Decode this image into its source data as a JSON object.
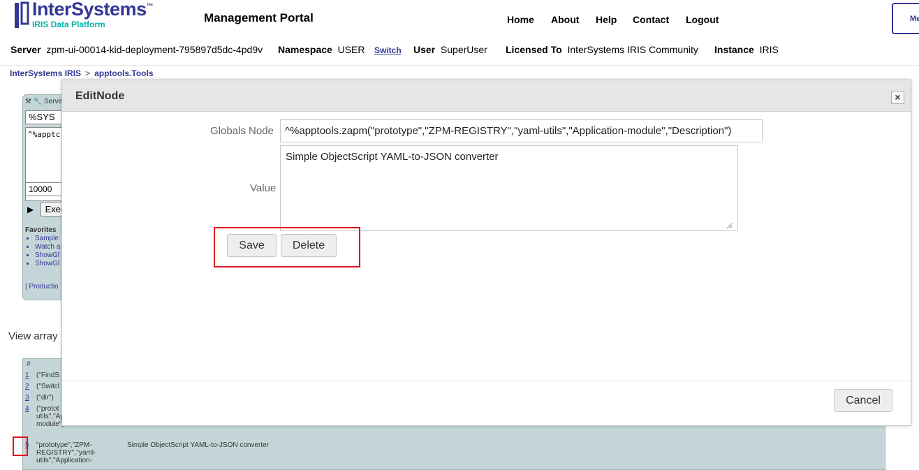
{
  "header": {
    "logo_name": "InterSystems",
    "logo_tm": "™",
    "logo_sub": "IRIS Data Platform",
    "portal_title": "Management Portal",
    "nav": [
      "Home",
      "About",
      "Help",
      "Contact",
      "Logout"
    ],
    "top_right_label": "Me"
  },
  "info": {
    "server_label": "Server",
    "server_value": "zpm-ui-00014-kid-deployment-795897d5dc-4pd9v",
    "namespace_label": "Namespace",
    "namespace_value": "USER",
    "switch_label": "Switch",
    "user_label": "User",
    "user_value": "SuperUser",
    "licensed_label": "Licensed To",
    "licensed_value": "InterSystems IRIS Community",
    "instance_label": "Instance",
    "instance_value": "IRIS"
  },
  "breadcrumb": {
    "root": "InterSystems IRIS",
    "sep": ">",
    "current": "apptools.Tools"
  },
  "panel": {
    "head": "Serve",
    "namespace": "%SYS",
    "global_ref": "^%apptc",
    "max_rows": "10000",
    "exec_label": "Exec",
    "favorites_title": "Favorites",
    "favorites": [
      "Sample",
      "Watch a",
      "ShowGl",
      "ShowGl"
    ],
    "production_link": "| Productio"
  },
  "view_array_label": "View array",
  "results": {
    "header": "#",
    "rows": [
      {
        "idx": "1",
        "key": "(\"FindS"
      },
      {
        "idx": "2",
        "key": "(\"Switcl"
      },
      {
        "idx": "3",
        "key": "(\"dir\")"
      },
      {
        "idx": "4",
        "key": "(\"protot REGIST utils\",\"Application-module\")"
      },
      {
        "idx": "5",
        "key": "\"prototype\",\"ZPM-REGISTRY\",\"yaml-utils\",\"Application-",
        "value": "Simple ObjectScript YAML-to-JSON converter"
      }
    ]
  },
  "modal": {
    "title": "EditNode",
    "close_glyph": "×",
    "globals_node_label": "Globals Node",
    "globals_node_value": "^%apptools.zapm(\"prototype\",\"ZPM-REGISTRY\",\"yaml-utils\",\"Application-module\",\"Description\")",
    "value_label": "Value",
    "value_text": "Simple ObjectScript YAML-to-JSON converter",
    "save_label": "Save",
    "delete_label": "Delete",
    "cancel_label": "Cancel"
  },
  "colors": {
    "brand": "#333695",
    "accent": "#00b2a9",
    "highlight": "#e0141e",
    "panel_bg": "#c5d6d8"
  }
}
